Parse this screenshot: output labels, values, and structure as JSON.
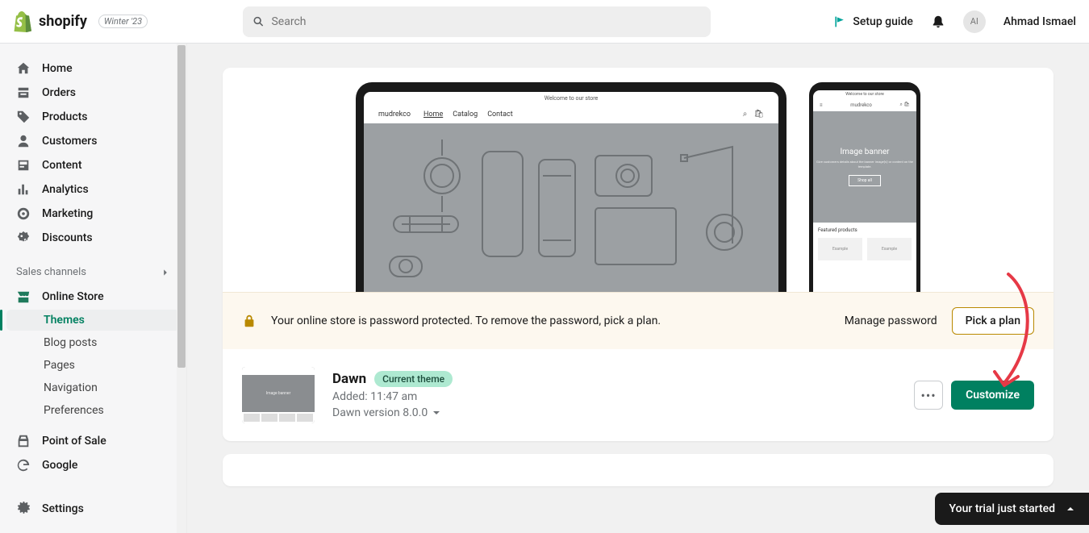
{
  "brand": {
    "name": "shopify",
    "tag": "Winter '23"
  },
  "search": {
    "placeholder": "Search"
  },
  "header": {
    "setup_guide": "Setup guide",
    "user_initials": "AI",
    "user_name": "Ahmad Ismael"
  },
  "nav": {
    "home": "Home",
    "orders": "Orders",
    "products": "Products",
    "customers": "Customers",
    "content": "Content",
    "analytics": "Analytics",
    "marketing": "Marketing",
    "discounts": "Discounts",
    "sales_channels": "Sales channels",
    "online_store": "Online Store",
    "themes": "Themes",
    "blog_posts": "Blog posts",
    "pages": "Pages",
    "navigation": "Navigation",
    "preferences": "Preferences",
    "pos": "Point of Sale",
    "google": "Google",
    "settings": "Settings"
  },
  "preview": {
    "announce": "Welcome to our store",
    "store_name": "mudrekco",
    "nav_home": "Home",
    "nav_catalog": "Catalog",
    "nav_contact": "Contact",
    "mobile_banner_title": "Image banner",
    "mobile_banner_sub": "Give customers details about the banner image(s) or content on the template.",
    "mobile_banner_btn": "Shop all",
    "mobile_featured": "Featured products",
    "mobile_example": "Example"
  },
  "alert": {
    "text": "Your online store is password protected. To remove the password, pick a plan.",
    "manage": "Manage password",
    "pick": "Pick a plan"
  },
  "theme": {
    "name": "Dawn",
    "badge": "Current theme",
    "added": "Added: 11:47 am",
    "version": "Dawn version 8.0.0",
    "customize": "Customize"
  },
  "trial": {
    "text": "Your trial just started"
  }
}
